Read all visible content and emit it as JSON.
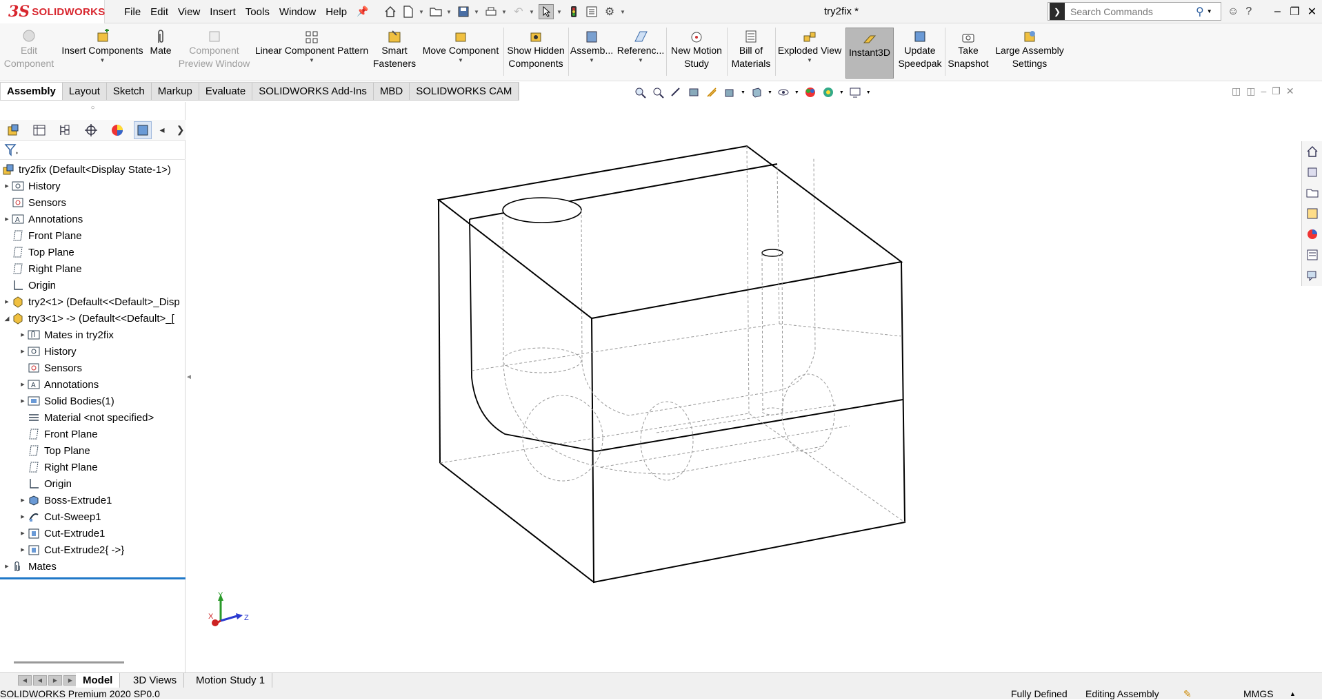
{
  "app": {
    "brand_ds": "3S",
    "brand_name": "SOLIDWORKS",
    "doc_title": "try2fix *"
  },
  "menu": [
    "File",
    "Edit",
    "View",
    "Insert",
    "Tools",
    "Window",
    "Help"
  ],
  "search": {
    "placeholder": "Search Commands"
  },
  "ribbon": {
    "edit_component": [
      "Edit",
      "Component"
    ],
    "insert_components": "Insert Components",
    "mate": "Mate",
    "component_preview": [
      "Component",
      "Preview Window"
    ],
    "linear_pattern": "Linear Component Pattern",
    "smart_fasteners": [
      "Smart",
      "Fasteners"
    ],
    "move_component": "Move Component",
    "show_hidden": [
      "Show Hidden",
      "Components"
    ],
    "assembly": "Assemb...",
    "reference": "Referenc...",
    "motion_study": [
      "New Motion",
      "Study"
    ],
    "bom": [
      "Bill of",
      "Materials"
    ],
    "exploded_view": "Exploded View",
    "instant3d": "Instant3D",
    "speedpak": [
      "Update",
      "Speedpak"
    ],
    "snapshot": [
      "Take",
      "Snapshot"
    ],
    "large_assembly": [
      "Large Assembly",
      "Settings"
    ]
  },
  "tabs": [
    "Assembly",
    "Layout",
    "Sketch",
    "Markup",
    "Evaluate",
    "SOLIDWORKS Add-Ins",
    "MBD",
    "SOLIDWORKS CAM"
  ],
  "tree": [
    {
      "label": "try2fix  (Default<Display State-1>)",
      "indent": 0,
      "exp": false,
      "icon": "assembly-icon"
    },
    {
      "label": "History",
      "indent": 1,
      "exp": true,
      "icon": "history-icon"
    },
    {
      "label": "Sensors",
      "indent": 1,
      "exp": false,
      "icon": "sensor-icon"
    },
    {
      "label": "Annotations",
      "indent": 1,
      "exp": true,
      "icon": "annotation-icon"
    },
    {
      "label": "Front Plane",
      "indent": 1,
      "exp": false,
      "icon": "plane-icon"
    },
    {
      "label": "Top Plane",
      "indent": 1,
      "exp": false,
      "icon": "plane-icon"
    },
    {
      "label": "Right Plane",
      "indent": 1,
      "exp": false,
      "icon": "plane-icon"
    },
    {
      "label": "Origin",
      "indent": 1,
      "exp": false,
      "icon": "origin-icon"
    },
    {
      "label": "try2<1> (Default<<Default>_Disp",
      "indent": 1,
      "exp": true,
      "icon": "part-icon"
    },
    {
      "label": "try3<1> -> (Default<<Default>_[",
      "indent": 1,
      "exp": true,
      "open": true,
      "icon": "part-icon"
    },
    {
      "label": "Mates in try2fix",
      "indent": 2,
      "exp": true,
      "icon": "mates-folder-icon"
    },
    {
      "label": "History",
      "indent": 2,
      "exp": true,
      "icon": "history-icon"
    },
    {
      "label": "Sensors",
      "indent": 2,
      "exp": false,
      "icon": "sensor-icon"
    },
    {
      "label": "Annotations",
      "indent": 2,
      "exp": true,
      "icon": "annotation-icon"
    },
    {
      "label": "Solid Bodies(1)",
      "indent": 2,
      "exp": true,
      "icon": "solid-bodies-icon"
    },
    {
      "label": "Material <not specified>",
      "indent": 2,
      "exp": false,
      "icon": "material-icon"
    },
    {
      "label": "Front Plane",
      "indent": 2,
      "exp": false,
      "icon": "plane-icon"
    },
    {
      "label": "Top Plane",
      "indent": 2,
      "exp": false,
      "icon": "plane-icon"
    },
    {
      "label": "Right Plane",
      "indent": 2,
      "exp": false,
      "icon": "plane-icon"
    },
    {
      "label": "Origin",
      "indent": 2,
      "exp": false,
      "icon": "origin-icon"
    },
    {
      "label": "Boss-Extrude1",
      "indent": 2,
      "exp": true,
      "icon": "extrude-icon"
    },
    {
      "label": "Cut-Sweep1",
      "indent": 2,
      "exp": true,
      "icon": "sweep-icon"
    },
    {
      "label": "Cut-Extrude1",
      "indent": 2,
      "exp": true,
      "icon": "cut-extrude-icon"
    },
    {
      "label": "Cut-Extrude2{ ->}",
      "indent": 2,
      "exp": true,
      "icon": "cut-extrude-icon"
    },
    {
      "label": "Mates",
      "indent": 1,
      "exp": true,
      "icon": "mates-icon"
    }
  ],
  "triad": {
    "y": "Y",
    "x": "X",
    "z": "Z"
  },
  "bottom_tabs": [
    "Model",
    "3D Views",
    "Motion Study 1"
  ],
  "status": {
    "product": "SOLIDWORKS Premium 2020 SP0.0",
    "defined": "Fully Defined",
    "mode": "Editing Assembly",
    "units": "MMGS"
  },
  "colors": {
    "accent": "#1f78c8",
    "brand": "#d8262e",
    "active_button": "#b8b8b8"
  }
}
